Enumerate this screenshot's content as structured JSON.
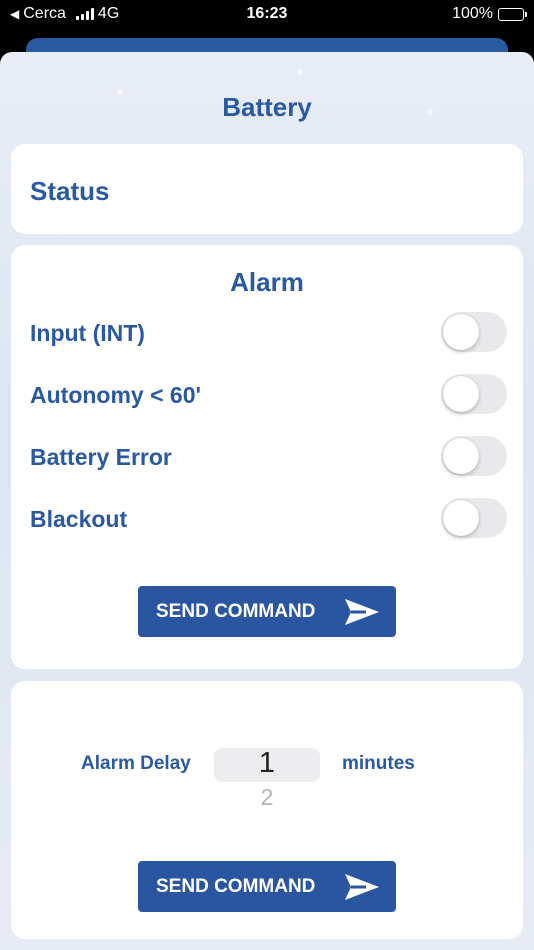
{
  "status_bar": {
    "back_label": "Cerca",
    "network": "4G",
    "time": "16:23",
    "battery_percent": "100%",
    "battery_level": 1.0,
    "signal_bars": 4
  },
  "screen": {
    "title": "Battery"
  },
  "status_card": {
    "label": "Status"
  },
  "alarm_card": {
    "heading": "Alarm",
    "items": [
      {
        "label": "Input (INT)",
        "enabled": false
      },
      {
        "label": "Autonomy < 60'",
        "enabled": false
      },
      {
        "label": "Battery Error",
        "enabled": false
      },
      {
        "label": "Blackout",
        "enabled": false
      }
    ],
    "send_button": "SEND COMMAND"
  },
  "delay_card": {
    "label": "Alarm Delay",
    "value": "1",
    "next_value": "2",
    "unit": "minutes",
    "send_button": "SEND COMMAND"
  },
  "colors": {
    "accent": "#2a59a3",
    "button": "#2a56a1",
    "toggle_off": "#e9e9eb"
  }
}
